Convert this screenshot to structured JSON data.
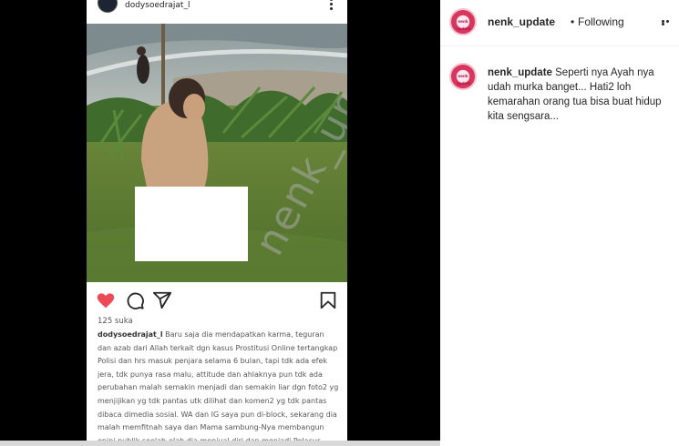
{
  "post_image": {
    "username": "dodysoedrajat_l",
    "watermark": "nenk_update",
    "likes": "125 suka",
    "caption_username": "dodysoedrajat_l",
    "caption_text": " Baru saja dia mendapatkan karma, teguran dan azab dari Allah terkait dgn kasus Prostitusi Online tertangkap Polisi dan hrs masuk penjara selama 6 bulan, tapi tdk ada efek jera, tdk punya rasa malu, attitude dan ahlaknya pun tdk ada perubahan malah semakin menjadi dan semakin liar dgn foto2 yg menjijikan yg tdk pantas utk dilihat dan komen2 yg tdk pantas dibaca dimedia sosial. WA dan IG saya pun di-block, sekarang dia malah memfitnah saya dan Mama sambung-Nya membangun opini publik seolah-olah dia menjual diri dan menjadi Pelacur Online gara-gara Saya dan Mama sambungnya..!",
    "icons": [
      "heart-filled-icon",
      "comment-icon",
      "share-icon",
      "bookmark-icon"
    ],
    "heart_color": "#ed4956"
  },
  "sidebar": {
    "avatar_text": "nenk update",
    "header": {
      "username": "nenk_update",
      "separator": "•",
      "following_label": "Following"
    },
    "comment": {
      "username": "nenk_update",
      "text": " Seperti nya Ayah nya udah murka banget... Hati2 loh kemarahan orang tua bisa buat hidup kita sengsara..."
    }
  }
}
